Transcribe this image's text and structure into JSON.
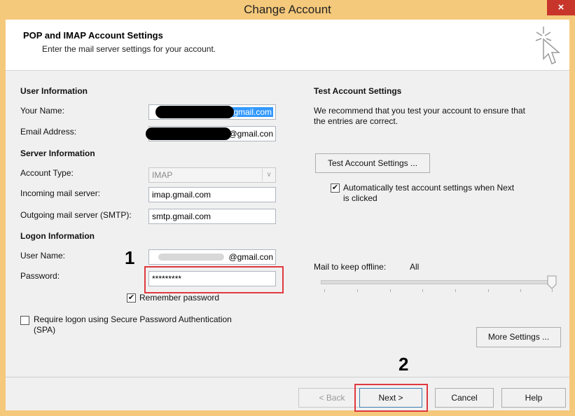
{
  "window": {
    "title": "Change Account",
    "close_glyph": "×"
  },
  "header": {
    "title": "POP and IMAP Account Settings",
    "subtitle": "Enter the mail server settings for your account.",
    "icon": "cursor-sparkle-icon"
  },
  "user_info": {
    "section": "User Information",
    "name_label": "Your Name:",
    "name_value_visible": "gmail.com",
    "email_label": "Email Address:",
    "email_value_visible": "@gmail.con"
  },
  "server_info": {
    "section": "Server Information",
    "account_type_label": "Account Type:",
    "account_type_value": "IMAP",
    "incoming_label": "Incoming mail server:",
    "incoming_value": "imap.gmail.com",
    "outgoing_label": "Outgoing mail server (SMTP):",
    "outgoing_value": "smtp.gmail.com"
  },
  "logon_info": {
    "section": "Logon Information",
    "username_label": "User Name:",
    "username_value_visible": "@gmail.con",
    "password_label": "Password:",
    "password_value": "*********",
    "remember_label": "Remember password",
    "remember_checked": true,
    "spa_label_line1": "Require logon using Secure Password Authentication",
    "spa_label_line2": "(SPA)",
    "spa_checked": false
  },
  "test_settings": {
    "section": "Test Account Settings",
    "description_line1": "We recommend that you test your account to ensure that",
    "description_line2": "the entries are correct.",
    "test_button": "Test Account Settings ...",
    "auto_test_line1": "Automatically test account settings when Next",
    "auto_test_line2": "is clicked",
    "auto_test_checked": true
  },
  "offline": {
    "label": "Mail to keep offline:",
    "value": "All",
    "slider_fraction": 1.0
  },
  "buttons": {
    "more_settings": "More Settings ...",
    "back": "< Back",
    "next": "Next >",
    "cancel": "Cancel",
    "help": "Help"
  },
  "annotations": {
    "step1": "1",
    "step2": "2",
    "highlight_color": "#e0393e"
  },
  "colors": {
    "frame": "#f5c97b",
    "close": "#c8352b"
  }
}
